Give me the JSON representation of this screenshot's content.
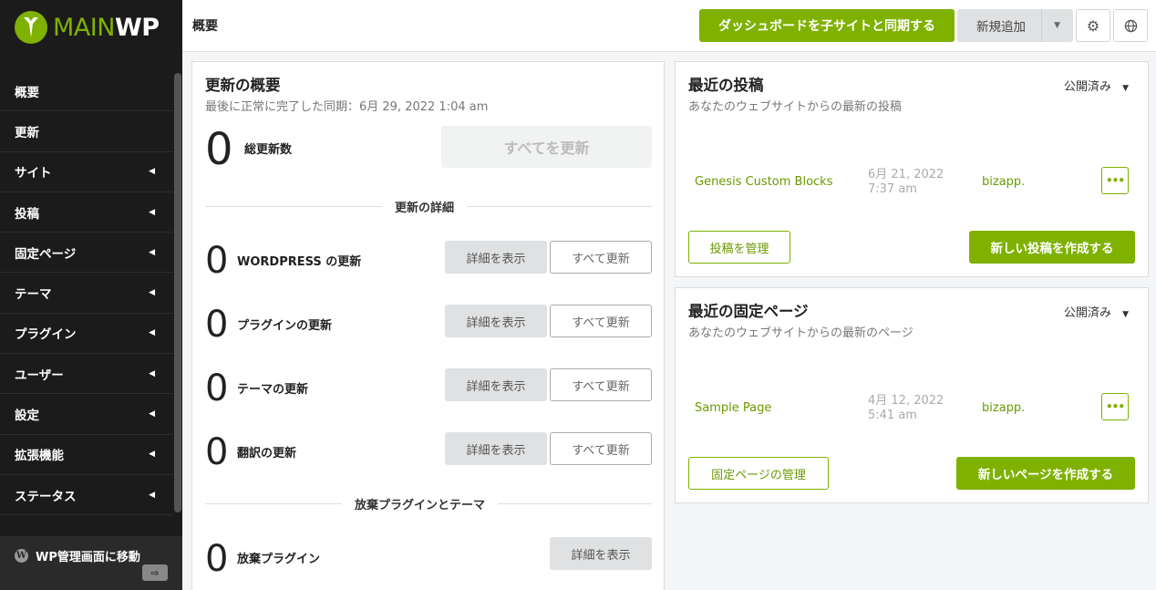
{
  "brand": {
    "main": "MAIN",
    "wp": "WP"
  },
  "sidebar": {
    "items": [
      {
        "label": "概要",
        "arrow": false
      },
      {
        "label": "更新",
        "arrow": false
      },
      {
        "label": "サイト",
        "arrow": true
      },
      {
        "label": "投稿",
        "arrow": true
      },
      {
        "label": "固定ページ",
        "arrow": true
      },
      {
        "label": "テーマ",
        "arrow": true
      },
      {
        "label": "プラグイン",
        "arrow": true
      },
      {
        "label": "ユーザー",
        "arrow": true
      },
      {
        "label": "設定",
        "arrow": true
      },
      {
        "label": "拡張機能",
        "arrow": true
      },
      {
        "label": "ステータス",
        "arrow": true
      }
    ],
    "wp_admin_label": "WP管理画面に移動"
  },
  "header": {
    "title": "概要",
    "sync_button": "ダッシュボードを子サイトと同期する",
    "add_new": "新規追加"
  },
  "updates": {
    "title": "更新の概要",
    "last_sync": "最後に正常に完了した同期：6月 29, 2022 1:04 am",
    "total_count": "0",
    "total_label": "総更新数",
    "update_all_button": "すべてを更新",
    "details_heading": "更新の詳細",
    "rows": [
      {
        "count": "0",
        "label": "WORDPRESS の更新",
        "view": "詳細を表示",
        "update": "すべて更新"
      },
      {
        "count": "0",
        "label": "プラグインの更新",
        "view": "詳細を表示",
        "update": "すべて更新"
      },
      {
        "count": "0",
        "label": "テーマの更新",
        "view": "詳細を表示",
        "update": "すべて更新"
      },
      {
        "count": "0",
        "label": "翻訳の更新",
        "view": "詳細を表示",
        "update": "すべて更新"
      }
    ],
    "abandoned_heading": "放棄プラグインとテーマ",
    "abandoned": {
      "count": "0",
      "label": "放棄プラグイン",
      "view": "詳細を表示"
    }
  },
  "recent_posts": {
    "title": "最近の投稿",
    "subtitle": "あなたのウェブサイトからの最新の投稿",
    "filter": "公開済み",
    "item": {
      "title": "Genesis Custom Blocks",
      "date": "6月 21, 2022",
      "time": "7:37 am",
      "site": "bizapp."
    },
    "manage_button": "投稿を管理",
    "create_button": "新しい投稿を作成する"
  },
  "recent_pages": {
    "title": "最近の固定ページ",
    "subtitle": "あなたのウェブサイトからの最新のページ",
    "filter": "公開済み",
    "item": {
      "title": "Sample Page",
      "date": "4月 12, 2022",
      "time": "5:41 am",
      "site": "bizapp."
    },
    "manage_button": "固定ページの管理",
    "create_button": "新しいページを作成する"
  },
  "colors": {
    "accent": "#7fb100",
    "sidebar_bg": "#1b1b1b"
  }
}
